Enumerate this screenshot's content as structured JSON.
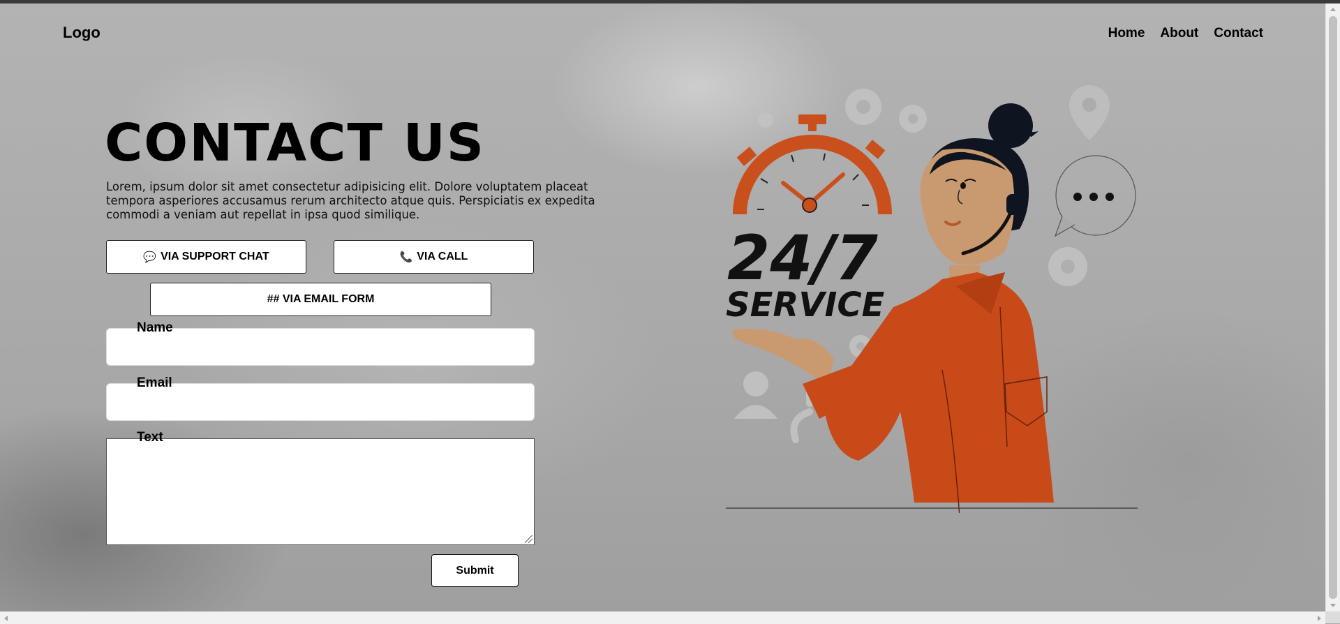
{
  "header": {
    "logo": "Logo",
    "nav": [
      {
        "label": "Home"
      },
      {
        "label": "About"
      },
      {
        "label": "Contact"
      }
    ]
  },
  "hero": {
    "title": "CONTACT US",
    "description": "Lorem, ipsum dolor sit amet consectetur adipisicing elit. Dolore voluptatem placeat tempora asperiores accusamus rerum architecto atque quis. Perspiciatis ex expedita commodi a veniam aut repellat in ipsa quod similique."
  },
  "options": {
    "chat": {
      "label": "VIA SUPPORT CHAT",
      "icon": "chat-bubble-icon"
    },
    "call": {
      "label": "VIA CALL",
      "icon": "phone-icon"
    },
    "email": {
      "label": "## VIA EMAIL FORM"
    }
  },
  "form": {
    "name_label": "Name",
    "name_value": "",
    "email_label": "Email",
    "email_value": "",
    "text_label": "Text",
    "text_value": "",
    "submit_label": "Submit"
  },
  "illustration": {
    "badge_top": "24/7",
    "badge_bottom": "SERVICE",
    "accent_color": "#c9501c"
  }
}
